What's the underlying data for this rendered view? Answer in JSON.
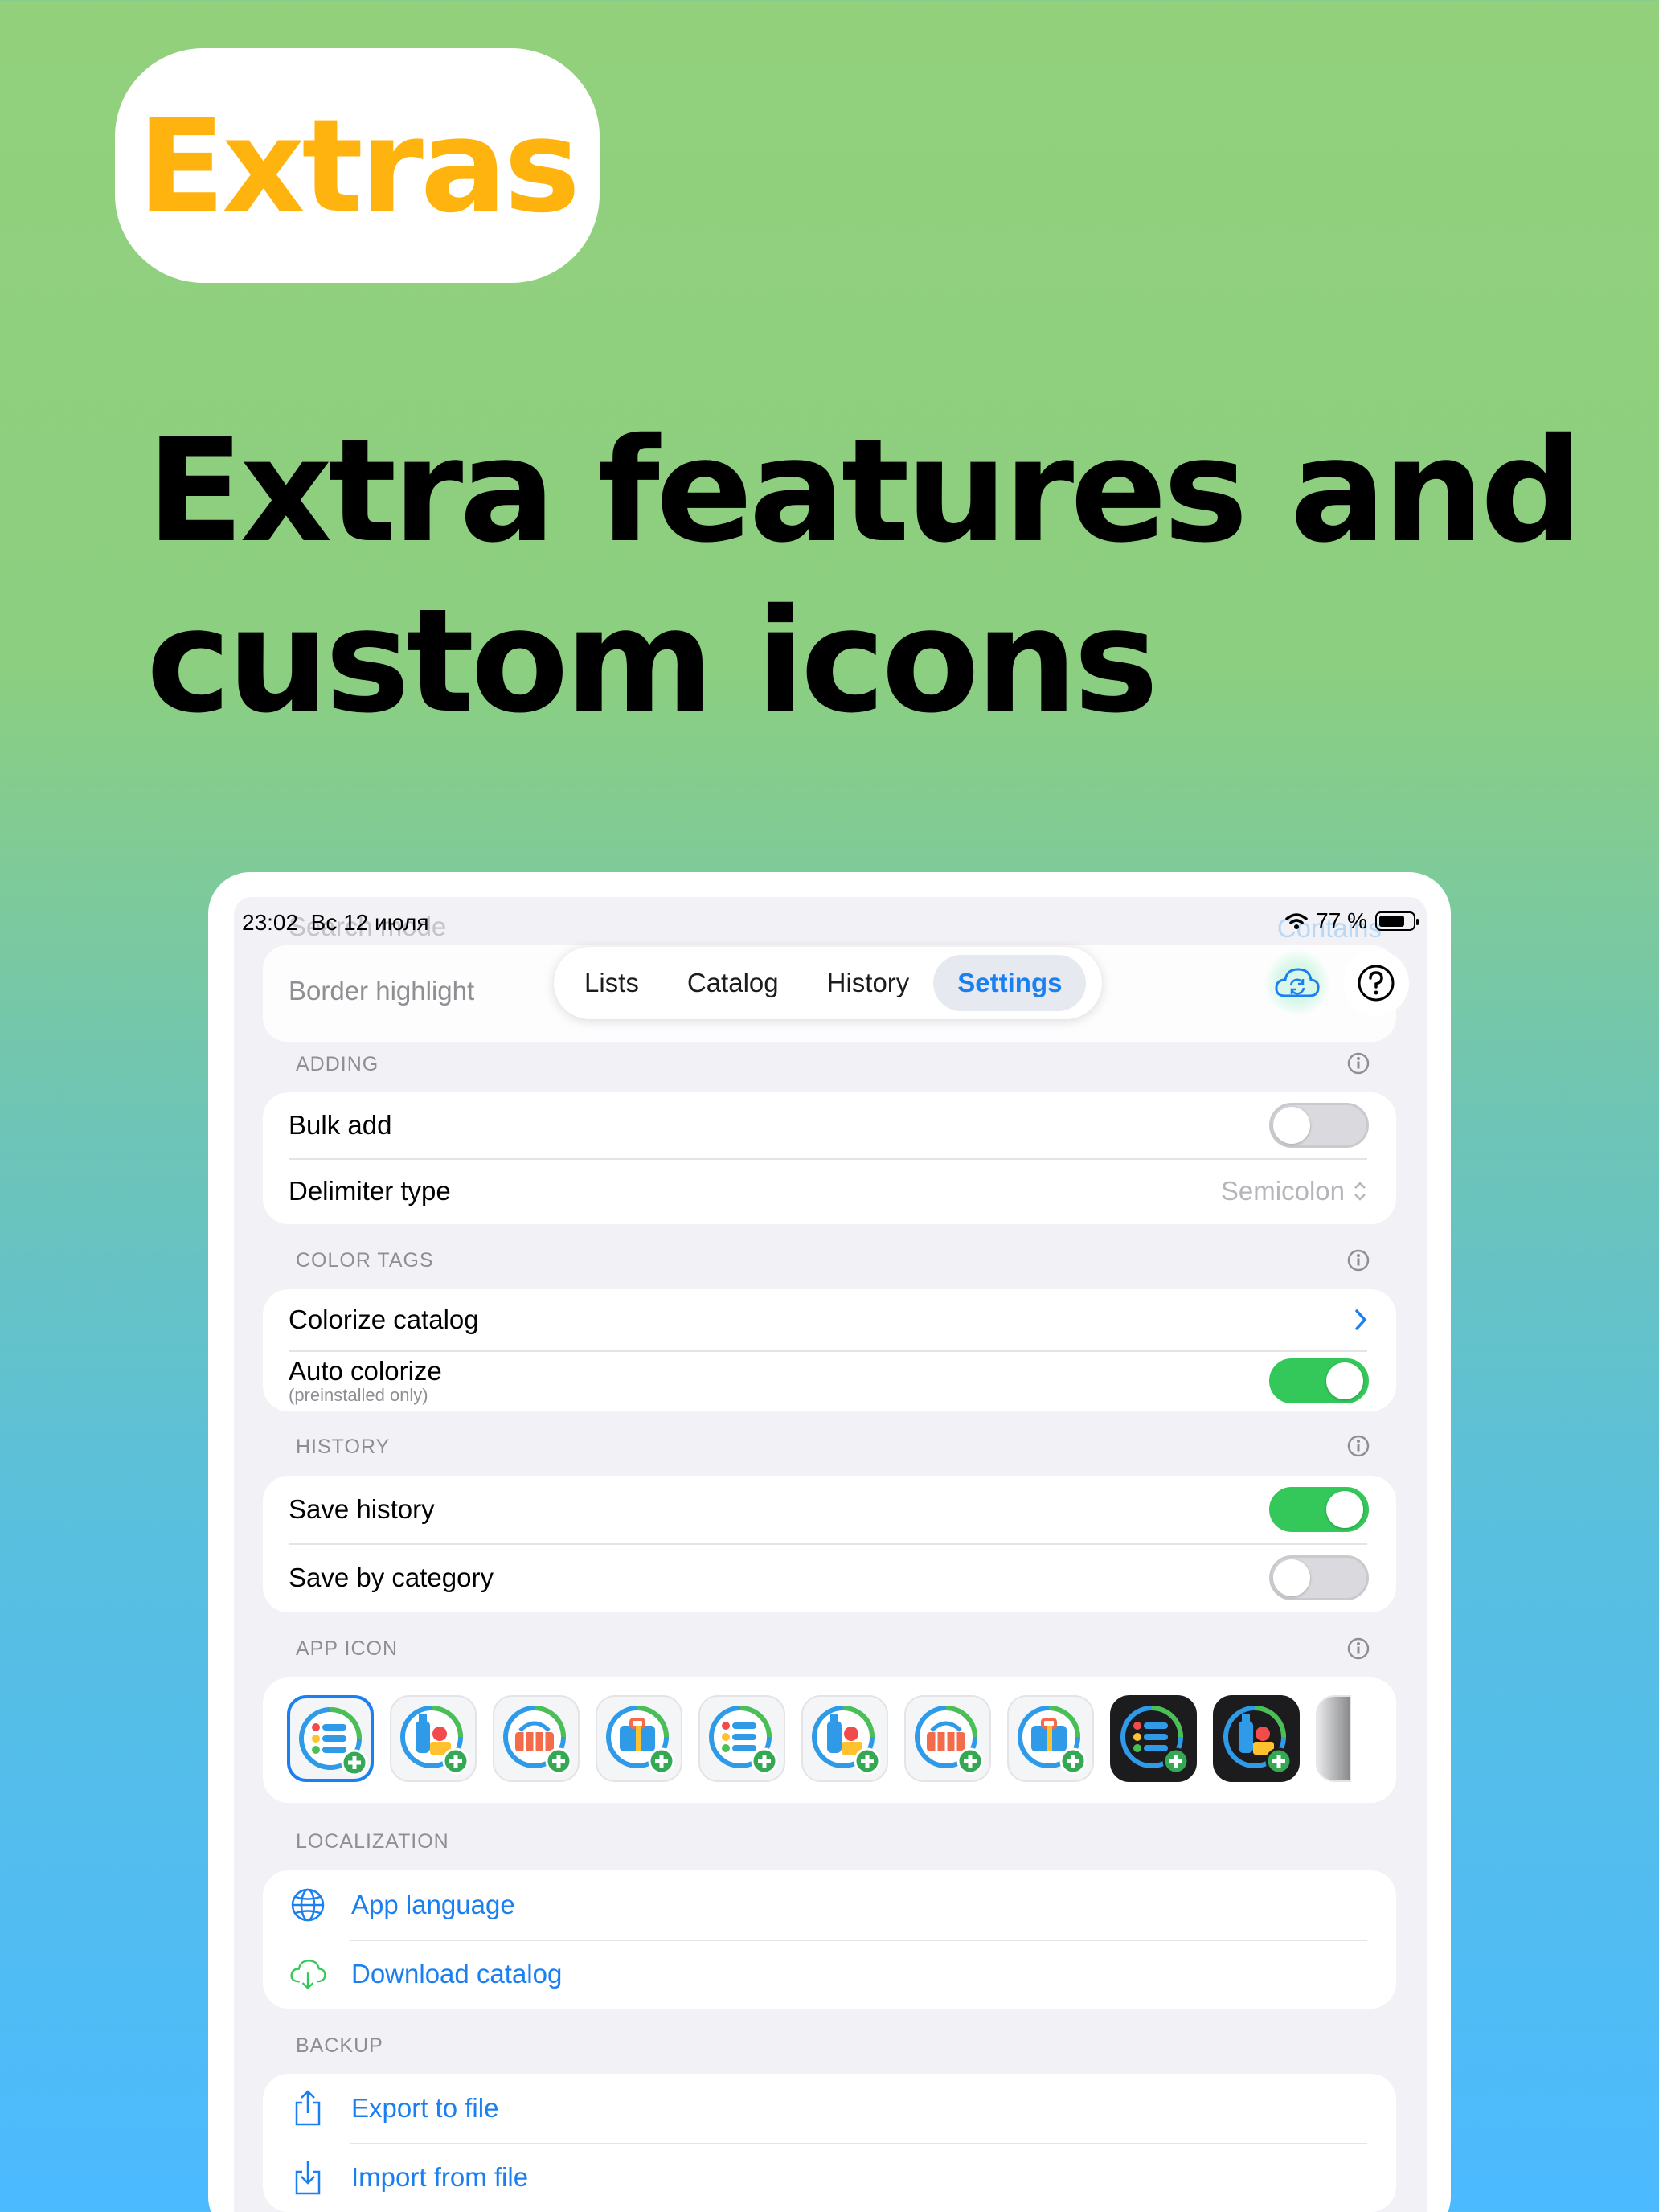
{
  "badge": {
    "text": "Extras"
  },
  "headline": {
    "line1": "Extra features and",
    "line2": "custom icons"
  },
  "status": {
    "time": "23:02",
    "date": "Вс 12 июля",
    "battery": "77 %",
    "battery_level": 0.77
  },
  "behind": {
    "search_mode": "Search mode",
    "contains": "Contains",
    "border_highlight": "Border highlight"
  },
  "tabs": [
    {
      "label": "Lists"
    },
    {
      "label": "Catalog"
    },
    {
      "label": "History"
    },
    {
      "label": "Settings"
    }
  ],
  "active_tab": "Settings",
  "sections": {
    "adding": {
      "title": "ADDING",
      "bulk_add": {
        "label": "Bulk add",
        "on": false
      },
      "delimiter": {
        "label": "Delimiter type",
        "value": "Semicolon"
      }
    },
    "color_tags": {
      "title": "COLOR TAGS",
      "colorize": {
        "label": "Colorize catalog"
      },
      "auto": {
        "label": "Auto colorize",
        "sub": "(preinstalled only)",
        "on": true
      }
    },
    "history": {
      "title": "HISTORY",
      "save_history": {
        "label": "Save history",
        "on": true
      },
      "save_by_category": {
        "label": "Save by category",
        "on": false
      }
    },
    "app_icon": {
      "title": "APP ICON",
      "icons": [
        "list-icon",
        "bottle-icon",
        "basket-icon",
        "suitcase-icon",
        "list-icon",
        "bottle-icon",
        "basket-icon",
        "suitcase-icon",
        "list-icon",
        "bottle-icon",
        "basket-icon"
      ]
    },
    "localization": {
      "title": "LOCALIZATION",
      "app_language": {
        "label": "App language"
      },
      "download_catalog": {
        "label": "Download catalog"
      }
    },
    "backup": {
      "title": "BACKUP",
      "export": {
        "label": "Export to file"
      },
      "import": {
        "label": "Import from file"
      }
    }
  },
  "colors": {
    "accent": "#1a7ff0",
    "toggle_on": "#34c759",
    "badge_text": "#ffb30f"
  }
}
